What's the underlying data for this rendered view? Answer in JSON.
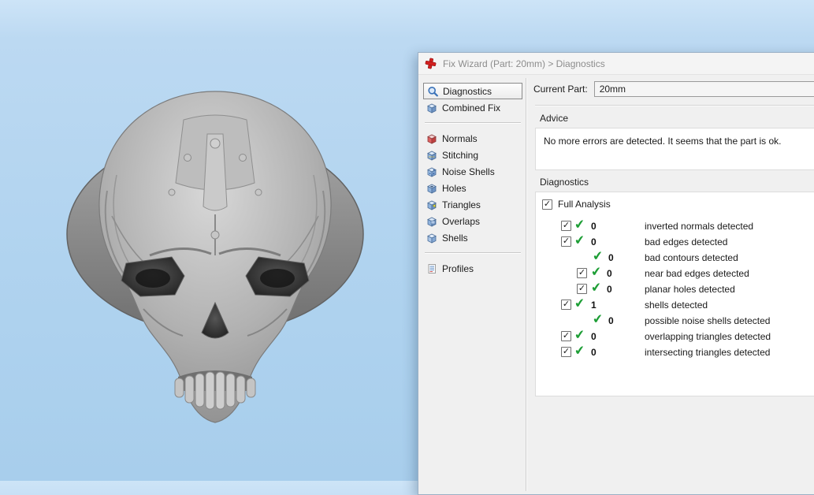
{
  "window": {
    "title": "Fix Wizard (Part: 20mm) > Diagnostics"
  },
  "viewport": {
    "model": "skull-ring-3d-model"
  },
  "icons": {
    "checkbox_check": "✓",
    "green_check": "✔"
  },
  "sidebar": {
    "items": [
      {
        "label": "Diagnostics"
      },
      {
        "label": "Combined Fix"
      },
      {
        "label": "Normals"
      },
      {
        "label": "Stitching"
      },
      {
        "label": "Noise Shells"
      },
      {
        "label": "Holes"
      },
      {
        "label": "Triangles"
      },
      {
        "label": "Overlaps"
      },
      {
        "label": "Shells"
      },
      {
        "label": "Profiles"
      }
    ]
  },
  "main": {
    "current_part_label": "Current Part:",
    "current_part_value": "20mm",
    "advice": {
      "group_label": "Advice",
      "text": "No more errors are detected. It seems that the part is ok."
    },
    "diagnostics": {
      "group_label": "Diagnostics",
      "full_analysis_label": "Full Analysis",
      "rows": [
        {
          "count": "0",
          "label": "inverted normals detected"
        },
        {
          "count": "0",
          "label": "bad edges detected"
        },
        {
          "count": "0",
          "label": "bad contours detected"
        },
        {
          "count": "0",
          "label": "near bad edges detected"
        },
        {
          "count": "0",
          "label": "planar holes detected"
        },
        {
          "count": "1",
          "label": "shells detected"
        },
        {
          "count": "0",
          "label": "possible noise shells detected"
        },
        {
          "count": "0",
          "label": "overlapping triangles detected"
        },
        {
          "count": "0",
          "label": "intersecting triangles detected"
        }
      ]
    }
  },
  "colors": {
    "status_ok": "#1e9e36",
    "brand_red": "#d42020",
    "viewport_top": "#cde4f7",
    "viewport_bottom": "#a8ceec"
  }
}
